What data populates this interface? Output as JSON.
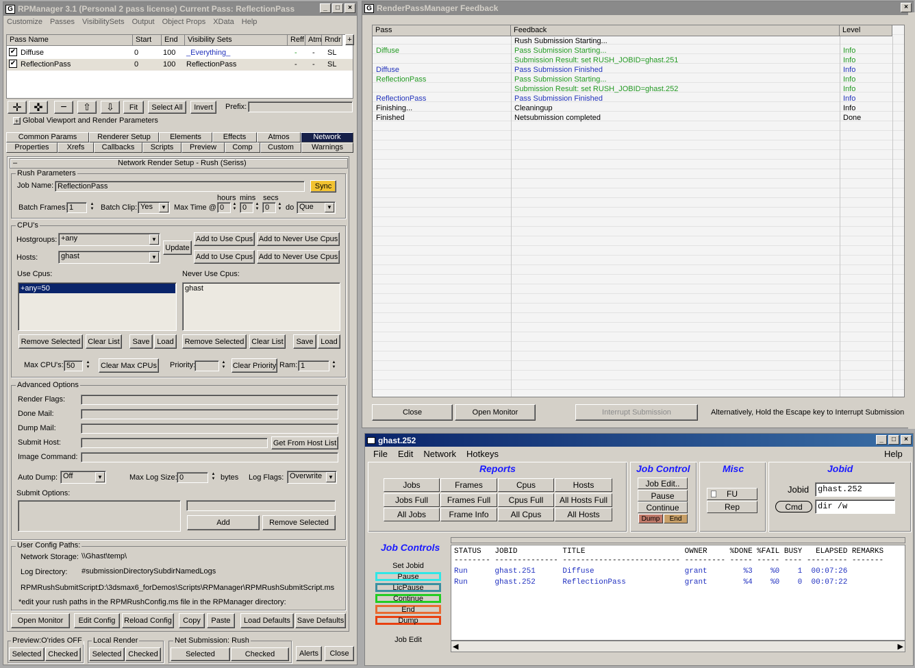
{
  "rpm": {
    "title": "RPManager 3.1 (Personal 2 pass license)   Current Pass: ReflectionPass",
    "menu": [
      "Customize",
      "Passes",
      "VisibilitySets",
      "Output",
      "Object Props",
      "XData",
      "Help"
    ],
    "pass_headers": [
      "Pass Name",
      "Start",
      "End",
      "Visibility Sets",
      "Reff",
      "Atm",
      "Rndr"
    ],
    "passes": [
      {
        "name": "Diffuse",
        "start": "0",
        "end": "100",
        "vis": "_Everything_",
        "reff": "-",
        "atm": "-",
        "rndr": "SL"
      },
      {
        "name": "ReflectionPass",
        "start": "0",
        "end": "100",
        "vis": "ReflectionPass",
        "reff": "-",
        "atm": "-",
        "rndr": "SL"
      }
    ],
    "scroll_plus": "+",
    "toolbar": {
      "fit": "Fit",
      "select_all": "Select All",
      "invert": "Invert",
      "prefix": "Prefix:"
    },
    "global_rollout": "Global Viewport and Render Parameters",
    "tabs_row1": [
      "Common Params",
      "Renderer Setup",
      "Elements",
      "Effects",
      "Atmos",
      "Network"
    ],
    "tabs_row2": [
      "Properties",
      "Xrefs",
      "Callbacks",
      "Scripts",
      "Preview",
      "Comp",
      "Custom",
      "Warnings"
    ],
    "net_title": "Network Render Setup - Rush (Seriss)",
    "rush": {
      "group": "Rush Parameters",
      "job_name_label": "Job Name:",
      "job_name": "ReflectionPass",
      "sync": "Sync",
      "batch_frames_label": "Batch Frames:",
      "batch_frames": "1",
      "batch_clip_label": "Batch Clip:",
      "batch_clip": "Yes",
      "max_time_label": "Max Time @",
      "hours": "hours",
      "mins": "mins",
      "secs": "secs",
      "h": "0",
      "m": "0",
      "s": "0",
      "do": "do",
      "que": "Que"
    },
    "cpus": {
      "group": "CPU's",
      "hostgroups_label": "Hostgroups:",
      "hostgroups": "+any",
      "hosts_label": "Hosts:",
      "hosts": "ghast",
      "update": "Update",
      "add_use": "Add to Use Cpus",
      "add_never": "Add to Never Use Cpus",
      "use_label": "Use Cpus:",
      "never_label": "Never Use Cpus:",
      "use_items": [
        "+any=50"
      ],
      "never_items": [
        "ghast"
      ],
      "remove_selected": "Remove Selected",
      "clear_list": "Clear List",
      "save": "Save",
      "load": "Load",
      "max_cpus_label": "Max CPU's:",
      "max_cpus": "50",
      "clear_max": "Clear Max CPUs",
      "priority_label": "Priority:",
      "clear_priority": "Clear Priority",
      "ram_label": "Ram:",
      "ram": "1"
    },
    "adv": {
      "group": "Advanced Options",
      "render_flags": "Render Flags:",
      "done_mail": "Done Mail:",
      "dump_mail": "Dump Mail:",
      "submit_host": "Submit Host:",
      "get_host": "Get From Host List",
      "image_command": "Image Command:",
      "auto_dump_label": "Auto Dump:",
      "auto_dump": "Off",
      "max_log_label": "Max Log Size:",
      "max_log": "0",
      "bytes": "bytes",
      "log_flags_label": "Log Flags:",
      "log_flags": "Overwrite",
      "submit_options": "Submit Options:",
      "add": "Add",
      "remove_selected": "Remove Selected"
    },
    "paths": {
      "title": "User Config Paths:",
      "network_storage": "Network Storage:",
      "network_storage_val": "\\\\Ghast\\temp\\",
      "log_dir": "Log Directory:",
      "log_dir_val": "#submissionDirectorySubdirNamedLogs",
      "script_label": "RPMRushSubmitScript:",
      "script_val": "D:\\3dsmax6_forDemos\\Scripts\\RPManager\\RPMRushSubmitScript.ms",
      "note": "*edit your rush paths in the RPMRushConfig.ms file in the RPManager directory:"
    },
    "bottom_buttons": [
      "Open Monitor",
      "Edit Config",
      "Reload Config",
      "Copy",
      "Paste",
      "Load Defaults",
      "Save Defaults"
    ],
    "footer": {
      "preview": "Preview:O'rides OFF",
      "local": "Local Render",
      "net": "Net Submission: Rush",
      "selected": "Selected",
      "checked": "Checked",
      "alerts": "Alerts",
      "close": "Close"
    }
  },
  "feedback": {
    "title": "RenderPassManager Feedback",
    "headers": [
      "Pass",
      "Feedback",
      "Level"
    ],
    "rows": [
      {
        "pass": "",
        "msg": "Rush Submission Starting...",
        "level": "",
        "color": "#000000"
      },
      {
        "pass": "Diffuse",
        "msg": "Pass Submission Starting...",
        "level": "Info",
        "color": "#229922"
      },
      {
        "pass": "",
        "msg": "Submission Result: set RUSH_JOBID=ghast.251",
        "level": "Info",
        "color": "#229922"
      },
      {
        "pass": "Diffuse",
        "msg": "Pass Submission Finished",
        "level": "Info",
        "color": "#2233bb"
      },
      {
        "pass": "ReflectionPass",
        "msg": "Pass Submission Starting...",
        "level": "Info",
        "color": "#229922"
      },
      {
        "pass": "",
        "msg": "Submission Result: set RUSH_JOBID=ghast.252",
        "level": "Info",
        "color": "#229922"
      },
      {
        "pass": "ReflectionPass",
        "msg": "Pass Submission Finished",
        "level": "Info",
        "color": "#2233bb"
      },
      {
        "pass": "Finishing...",
        "msg": "Cleaningup",
        "level": "Info",
        "color": "#000000"
      },
      {
        "pass": "Finished",
        "msg": "Netsubmission completed",
        "level": "Done",
        "color": "#000000"
      }
    ],
    "close": "Close",
    "open_monitor": "Open Monitor",
    "interrupt": "Interrupt Submission",
    "hint": "Alternatively, Hold the Escape key  to Interrupt Submission"
  },
  "ghast": {
    "title": "ghast.252",
    "menu": [
      "File",
      "Edit",
      "Network",
      "Hotkeys"
    ],
    "help": "Help",
    "reports": "Reports",
    "report_buttons": [
      "Jobs",
      "Frames",
      "Cpus",
      "Hosts",
      "Jobs Full",
      "Frames Full",
      "Cpus Full",
      "All Hosts Full",
      "All Jobs",
      "Frame Info",
      "All Cpus",
      "All Hosts"
    ],
    "job_control": "Job Control",
    "jc_buttons": [
      "Job Edit..",
      "Pause",
      "Continue"
    ],
    "dump": "Dump",
    "end": "End",
    "misc": "Misc",
    "fu": "FU",
    "rep": "Rep",
    "jobid_section": "Jobid",
    "jobid_label": "Jobid",
    "jobid": "ghast.252",
    "cmd": "Cmd",
    "cmd_val": "dir /w",
    "job_controls": "Job Controls",
    "side_buttons": [
      "Set Jobid",
      "Pause",
      "LicPause",
      "Continue",
      "End",
      "Dump",
      "Job Edit"
    ],
    "list_header": "STATUS   JOBID          TITLE                      OWNER     %DONE %FAIL BUSY   ELAPSED REMARKS",
    "list_sep": "-------- -------------- -------------------------- --------- ----- ----- ---- --------- -------",
    "list_rows": [
      "Run      ghast.251      Diffuse                    grant        %3    %0    1  00:07:26",
      "Run      ghast.252      ReflectionPass             grant        %4    %0    0  00:07:22"
    ]
  }
}
